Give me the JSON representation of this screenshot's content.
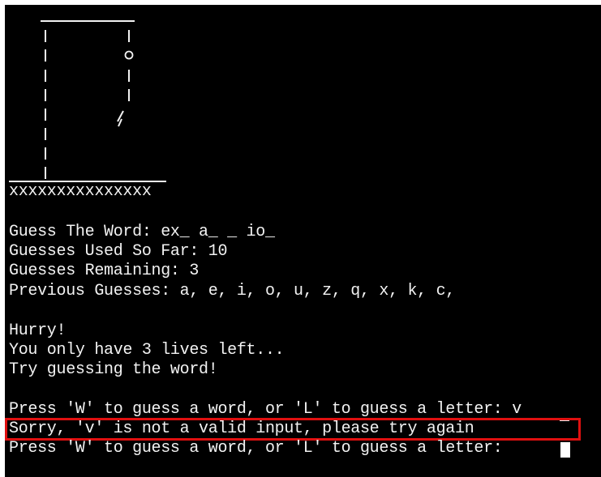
{
  "hangman": {
    "platform": "xxxxxxxxxxxxxxx"
  },
  "status": {
    "word": "Guess The Word: ex_ a_ _ io_",
    "used": "Guesses Used So Far: 10",
    "remaining": "Guesses Remaining: 3",
    "previous": "Previous Guesses: a, e, i, o, u, z, q, x, k, c,"
  },
  "warning": {
    "line1": "Hurry!",
    "line2": "You only have 3 lives left...",
    "line3": "Try guessing the word!"
  },
  "prompts": {
    "prompt1": "Press 'W' to guess a word, or 'L' to guess a letter: v",
    "error": "Sorry, 'v' is not a valid input, please try again",
    "prompt2": "Press 'W' to guess a word, or 'L' to guess a letter: "
  },
  "colors": {
    "background": "#000000",
    "text": "#f2f2f2",
    "highlight": "#e01010"
  }
}
